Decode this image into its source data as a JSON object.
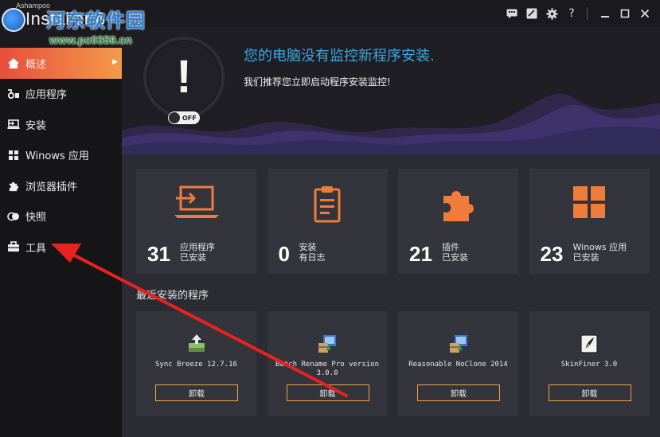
{
  "app": {
    "brand_top": "Ashampoo",
    "brand_name": "Installer 8",
    "watermark_title": "河东软件园",
    "watermark_url": "www.pc0359.cn"
  },
  "titlebar": {
    "icons": [
      "chat-icon",
      "feedback-icon",
      "gear-icon",
      "help-icon",
      "minimize-icon",
      "maximize-icon",
      "close-icon"
    ],
    "help_label": "?"
  },
  "sidebar": {
    "items": [
      {
        "label": "概述",
        "icon": "home-icon",
        "active": true
      },
      {
        "label": "应用程序",
        "icon": "apps-icon"
      },
      {
        "label": "安装",
        "icon": "install-icon"
      },
      {
        "label": "Winows 应用",
        "icon": "windows-icon"
      },
      {
        "label": "浏览器插件",
        "icon": "puzzle-icon"
      },
      {
        "label": "快照",
        "icon": "snapshot-icon"
      },
      {
        "label": "工具",
        "icon": "toolbox-icon"
      }
    ]
  },
  "hero": {
    "title": "您的电脑没有监控新程序安装.",
    "subtitle": "我们推荐您立即启动程序安装监控!",
    "alert_symbol": "!",
    "toggle_label": "OFF"
  },
  "stats": [
    {
      "number": "31",
      "line1": "应用程序",
      "line2": "已安装",
      "icon": "laptop-install-icon"
    },
    {
      "number": "0",
      "line1": "安装",
      "line2": "有日志",
      "icon": "clipboard-icon"
    },
    {
      "number": "21",
      "line1": "插件",
      "line2": "已安装",
      "icon": "puzzle-icon"
    },
    {
      "number": "23",
      "line1": "Winows 应用",
      "line2": "已安装",
      "icon": "windows-tiles-icon"
    }
  ],
  "recent": {
    "title": "最近安装的程序",
    "programs": [
      {
        "name": "Sync Breeze 12.7.16",
        "button": "卸载",
        "icon": "sync-breeze-icon"
      },
      {
        "name": "Batch Rename Pro version 3.0.0",
        "button": "卸载",
        "icon": "installer-box-icon"
      },
      {
        "name": "Reasonable NoClone 2014",
        "button": "卸载",
        "icon": "installer-box-icon"
      },
      {
        "name": "SkinFiner 3.0",
        "button": "卸载",
        "icon": "skinfiner-icon"
      }
    ]
  },
  "colors": {
    "accent_orange": "#f08a3c",
    "accent_red": "#e84e3c",
    "accent_blue": "#38a8e0",
    "card_bg": "#34343d",
    "annotation_red": "#e8231e"
  }
}
